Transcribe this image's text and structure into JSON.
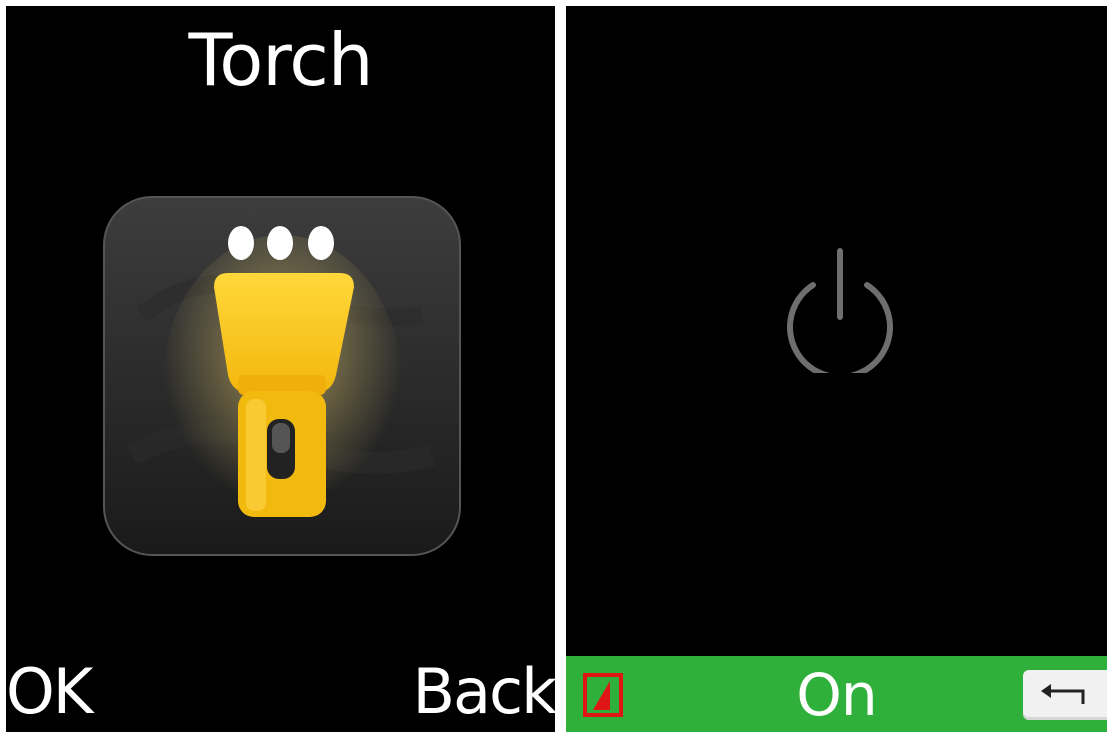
{
  "left_screen": {
    "title": "Torch",
    "app_icon": "flashlight-icon",
    "softkeys": {
      "left": "OK",
      "right": "Back"
    }
  },
  "right_screen": {
    "center_icon": "power-icon",
    "bottom_bar": {
      "label": "On",
      "left_icon": "signal-indicator-icon",
      "right_icon": "back-arrow-icon",
      "color": "#2eb03a"
    }
  },
  "colors": {
    "background": "#000000",
    "text": "#ffffff",
    "torch_yellow": "#f7c51c",
    "icon_gray": "#6e6e6e",
    "indicator_red": "#e01616"
  }
}
